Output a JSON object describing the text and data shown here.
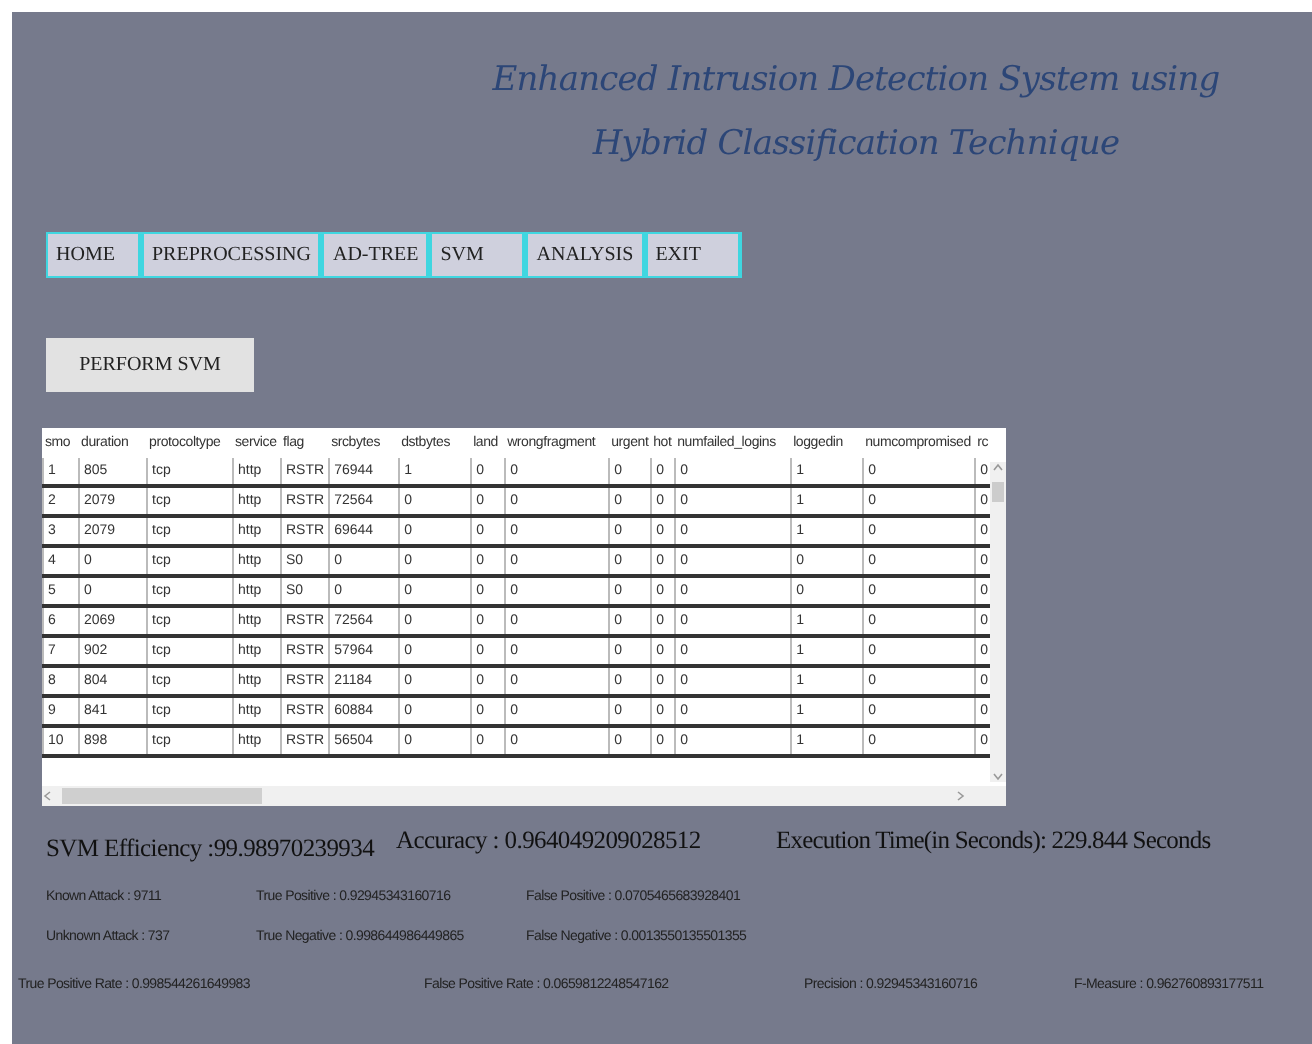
{
  "window": {
    "title_lines": [
      "Enhanced Intrusion Detection System using",
      "Hybrid  Classification Technique"
    ]
  },
  "menu": [
    "HOME",
    "PREPROCESSING",
    "AD-TREE",
    "SVM",
    "ANALYSIS",
    "EXIT"
  ],
  "action_button": "PERFORM SVM",
  "table": {
    "columns": [
      "smo",
      "duration",
      "protocoltype",
      "service",
      "flag",
      "srcbytes",
      "dstbytes",
      "land",
      "wrongfragment",
      "urgent",
      "hot",
      "numfailed_logins",
      "loggedin",
      "numcompromised",
      "rc"
    ],
    "rows": [
      [
        "1",
        "805",
        "tcp",
        "http",
        "RSTR",
        "76944",
        "1",
        "0",
        "0",
        "0",
        "0",
        "0",
        "1",
        "0",
        "0"
      ],
      [
        "2",
        "2079",
        "tcp",
        "http",
        "RSTR",
        "72564",
        "0",
        "0",
        "0",
        "0",
        "0",
        "0",
        "1",
        "0",
        "0"
      ],
      [
        "3",
        "2079",
        "tcp",
        "http",
        "RSTR",
        "69644",
        "0",
        "0",
        "0",
        "0",
        "0",
        "0",
        "1",
        "0",
        "0"
      ],
      [
        "4",
        "0",
        "tcp",
        "http",
        "S0",
        "0",
        "0",
        "0",
        "0",
        "0",
        "0",
        "0",
        "0",
        "0",
        "0"
      ],
      [
        "5",
        "0",
        "tcp",
        "http",
        "S0",
        "0",
        "0",
        "0",
        "0",
        "0",
        "0",
        "0",
        "0",
        "0",
        "0"
      ],
      [
        "6",
        "2069",
        "tcp",
        "http",
        "RSTR",
        "72564",
        "0",
        "0",
        "0",
        "0",
        "0",
        "0",
        "1",
        "0",
        "0"
      ],
      [
        "7",
        "902",
        "tcp",
        "http",
        "RSTR",
        "57964",
        "0",
        "0",
        "0",
        "0",
        "0",
        "0",
        "1",
        "0",
        "0"
      ],
      [
        "8",
        "804",
        "tcp",
        "http",
        "RSTR",
        "21184",
        "0",
        "0",
        "0",
        "0",
        "0",
        "0",
        "1",
        "0",
        "0"
      ],
      [
        "9",
        "841",
        "tcp",
        "http",
        "RSTR",
        "60884",
        "0",
        "0",
        "0",
        "0",
        "0",
        "0",
        "1",
        "0",
        "0"
      ],
      [
        "10",
        "898",
        "tcp",
        "http",
        "RSTR",
        "56504",
        "0",
        "0",
        "0",
        "0",
        "0",
        "0",
        "1",
        "0",
        "0"
      ]
    ]
  },
  "summary": [
    "SVM Efficiency :99.98970239934",
    "Accuracy : 0.964049209028512",
    "Execution Time(in Seconds): 229.844 Seconds"
  ],
  "details": [
    [
      "Known Attack : 9711",
      "True Positive : 0.92945343160716",
      "False Positive : 0.0705465683928401"
    ],
    [
      "Unknown Attack : 737",
      "True Negative : 0.998644986449865",
      "False Negative : 0.0013550135501355"
    ]
  ],
  "rates": [
    "True Positive Rate : 0.998544261649983",
    "False Positive Rate : 0.0659812248547162",
    "Precision : 0.92945343160716",
    "F-Measure : 0.962760893177511"
  ]
}
